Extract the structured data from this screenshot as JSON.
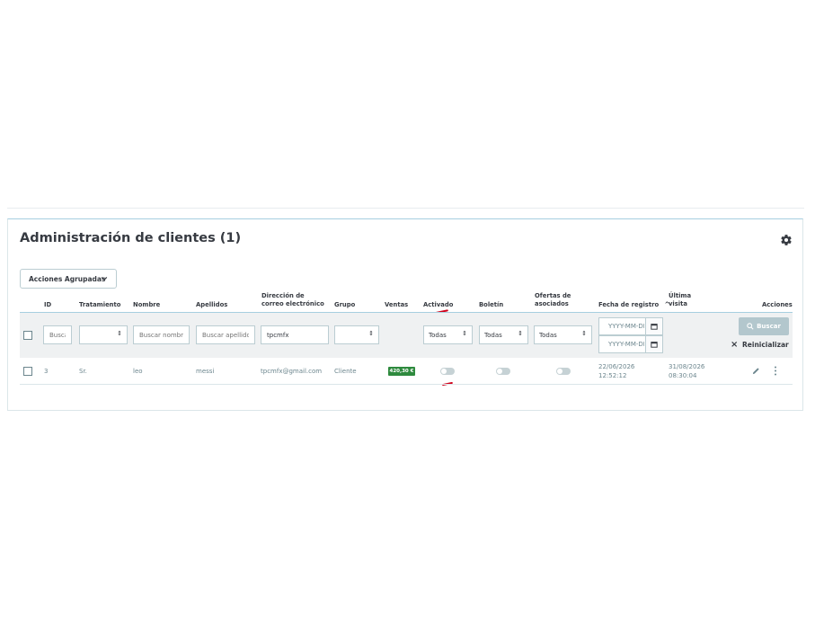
{
  "page": {
    "title": "Administración de clientes (1)",
    "bulk_actions_label": "Acciones Agrupadas"
  },
  "columns": {
    "id": "ID",
    "social_title": "Tratamiento",
    "firstname": "Nombre",
    "lastname": "Apellidos",
    "email_line1": "Dirección de",
    "email_line2": "correo electrónico",
    "group": "Grupo",
    "sales": "Ventas",
    "active": "Activado",
    "newsletter": "Boletín",
    "optin_line1": "Ofertas de",
    "optin_line2": "asociados",
    "date_add": "Fecha de registro",
    "last_visit_line1": "Última",
    "last_visit_line2": "visita",
    "actions": "Acciones"
  },
  "filters": {
    "id_placeholder": "Buscar ID",
    "firstname_placeholder": "Buscar nombre",
    "lastname_placeholder": "Buscar apellidos",
    "email_value": "tpcmfx",
    "active_value": "Todas",
    "newsletter_value": "Todas",
    "optin_value": "Todas",
    "date_from_placeholder": "YYYY-MM-DD",
    "date_to_placeholder": "YYYY-MM-DD",
    "search_label": "Buscar",
    "reset_label": "Reinicializar"
  },
  "rows": [
    {
      "id": "3",
      "social_title": "Sr.",
      "firstname": "leo",
      "lastname": "messi",
      "email": "tpcmfx@gmail.com",
      "group": "Cliente",
      "sales": "420,30 €",
      "active": false,
      "newsletter": false,
      "optin": false,
      "date_add_date": "22/06/2026",
      "date_add_time": "12:52:12",
      "last_visit_date": "31/08/2026",
      "last_visit_time": "08:30:04"
    }
  ],
  "colors": {
    "accent_border": "#a6cfe0",
    "sales_badge": "#2e8a3e",
    "annotation_red": "#d0021b",
    "search_button": "#b3c7cd"
  }
}
